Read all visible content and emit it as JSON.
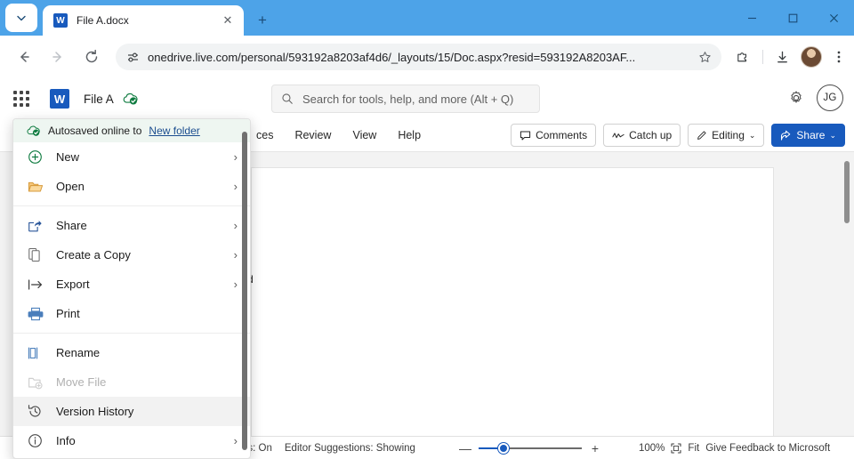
{
  "browser": {
    "tab_search_icon": "chevron-down-icon",
    "tab": {
      "favicon_letter": "W",
      "title": "File A.docx",
      "close_icon": "✕"
    },
    "new_tab_icon": "+",
    "window_controls": {
      "minimize": "—",
      "maximize": "▢",
      "close": "✕"
    },
    "nav": {
      "back_icon": "←",
      "forward_icon": "→",
      "reload_icon": "⟳"
    },
    "omnibox": {
      "site_settings_icon": "tune-icon",
      "url": "onedrive.live.com/personal/593192a8203af4d6/_layouts/15/Doc.aspx?resid=593192A8203AF...",
      "bookmark_icon": "star-icon"
    },
    "toolbar_icons": {
      "extensions": "puzzle-icon",
      "downloads": "download-icon",
      "profile": "profile-avatar",
      "menu": "three-dot-menu-icon"
    },
    "titlebar_color": "#4da3e8"
  },
  "word_header": {
    "app_launcher_icon": "waffle-grid-icon",
    "app_icon_letter": "W",
    "document_name": "File A",
    "saved_badge_icon": "cloud-check-icon",
    "search_placeholder": "Search for tools, help, and more (Alt + Q)",
    "search_icon": "search-icon",
    "settings_icon": "gear-icon",
    "avatar_initials": "JG"
  },
  "ribbon": {
    "tabs": [
      {
        "label": "ces"
      },
      {
        "label": "Review"
      },
      {
        "label": "View"
      },
      {
        "label": "Help"
      }
    ],
    "buttons": [
      {
        "label": "Comments",
        "icon": "comment-icon"
      },
      {
        "label": "Catch up",
        "icon": "activity-icon"
      },
      {
        "label": "Editing",
        "icon": "pencil-icon",
        "caret": "⌄"
      },
      {
        "label": "Share",
        "icon": "share-icon",
        "caret": "⌄",
        "primary": true
      }
    ]
  },
  "document": {
    "text_fragment": "d"
  },
  "status_bar": {
    "left_items": [
      "ns: On",
      "Editor Suggestions: Showing"
    ],
    "zoom_out_icon": "—",
    "zoom_in_icon": "+",
    "zoom_level": "100%",
    "fit_icon": "fit-icon",
    "fit_label": "Fit",
    "feedback_label": "Give Feedback to Microsoft"
  },
  "file_menu": {
    "autosave": {
      "icon": "cloud-check-icon",
      "text": "Autosaved online to",
      "link": "New folder"
    },
    "items": [
      {
        "label": "New",
        "icon": "plus-circle-icon",
        "chevron": "›",
        "disabled": false,
        "hovered": false
      },
      {
        "label": "Open",
        "icon": "folder-icon",
        "chevron": "›",
        "disabled": false,
        "hovered": false
      },
      {
        "label": "Share",
        "icon": "share-icon",
        "chevron": "›",
        "disabled": false,
        "hovered": false
      },
      {
        "label": "Create a Copy",
        "icon": "copy-icon",
        "chevron": "›",
        "disabled": false,
        "hovered": false
      },
      {
        "label": "Export",
        "icon": "export-icon",
        "chevron": "›",
        "disabled": false,
        "hovered": false
      },
      {
        "label": "Print",
        "icon": "printer-icon",
        "chevron": "",
        "disabled": false,
        "hovered": false
      },
      {
        "label": "Rename",
        "icon": "rename-icon",
        "chevron": "",
        "disabled": false,
        "hovered": false
      },
      {
        "label": "Move File",
        "icon": "move-file-icon",
        "chevron": "",
        "disabled": true,
        "hovered": false
      },
      {
        "label": "Version History",
        "icon": "history-icon",
        "chevron": "",
        "disabled": false,
        "hovered": true
      },
      {
        "label": "Info",
        "icon": "info-icon",
        "chevron": "›",
        "disabled": false,
        "hovered": false
      }
    ]
  },
  "colors": {
    "accent": "#185abd",
    "titlebar": "#4da3e8",
    "canvas": "#f3f3f3",
    "autosave_bg": "#eef6f1"
  }
}
